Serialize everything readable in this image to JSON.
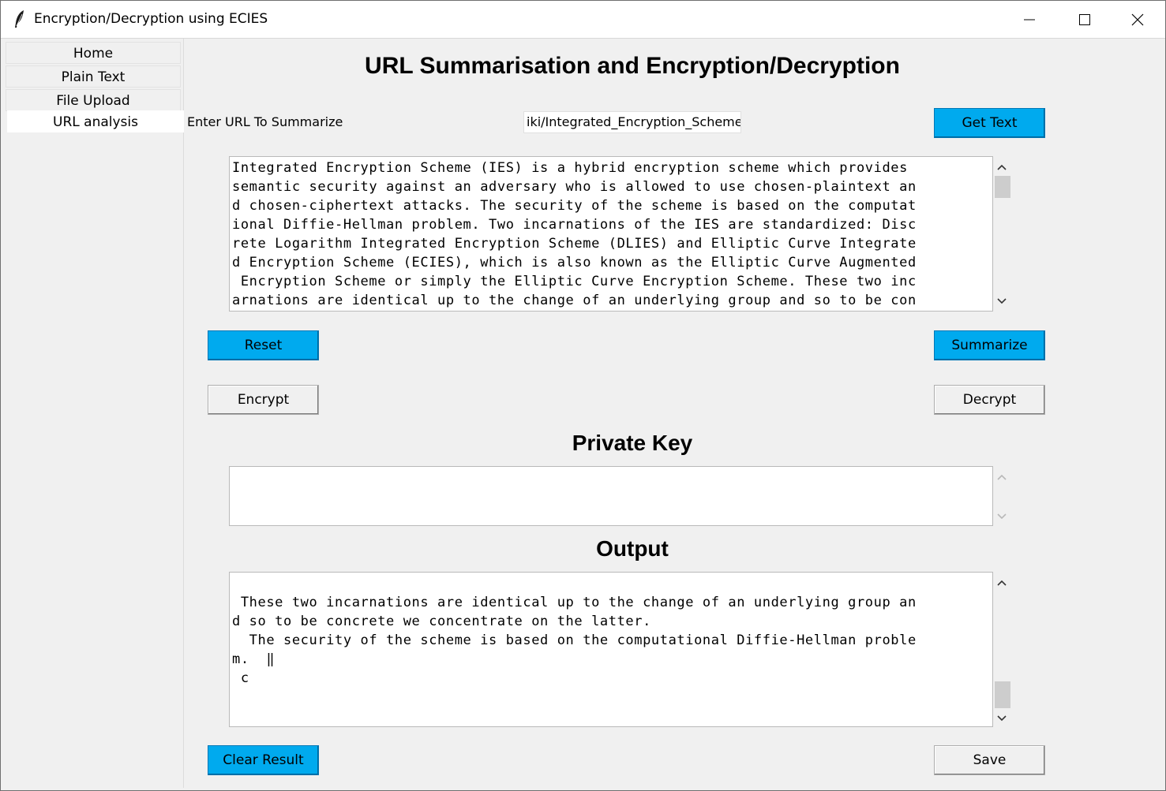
{
  "window": {
    "title": "Encryption/Decryption using ECIES"
  },
  "sidebar": {
    "items": [
      {
        "label": "Home"
      },
      {
        "label": "Plain Text"
      },
      {
        "label": "File Upload"
      },
      {
        "label": "URL analysis"
      }
    ],
    "active_index": 3
  },
  "main": {
    "page_title": "URL Summarisation and Encryption/Decryption",
    "url_label": "Enter URL To Summarize",
    "url_value": "iki/Integrated_Encryption_Scheme",
    "get_text_label": "Get Text",
    "input_text_lines": [
      "Integrated Encryption Scheme (IES) is a hybrid encryption scheme which provides",
      "semantic security against an adversary who is allowed to use chosen-plaintext an",
      "d chosen-ciphertext attacks. The security of the scheme is based on the computat",
      "ional Diffie-Hellman problem. Two incarnations of the IES are standardized: Disc",
      "rete Logarithm Integrated Encryption Scheme (DLIES) and Elliptic Curve Integrate",
      "d Encryption Scheme (ECIES), which is also known as the Elliptic Curve Augmented",
      " Encryption Scheme or simply the Elliptic Curve Encryption Scheme. These two inc",
      "arnations are identical up to the change of an underlying group and so to be con"
    ],
    "reset_label": "Reset",
    "summarize_label": "Summarize",
    "encrypt_label": "Encrypt",
    "decrypt_label": "Decrypt",
    "private_key_heading": "Private Key",
    "private_key_value": "",
    "output_heading": "Output",
    "output_text_lines": [
      "",
      " These two incarnations are identical up to the change of an underlying group an",
      "d so to be concrete we concentrate on the latter.",
      "  The security of the scheme is based on the computational Diffie-Hellman proble",
      "m.  ‖",
      " c"
    ],
    "clear_result_label": "Clear Result",
    "save_label": "Save"
  },
  "colors": {
    "accent_button": "#00aaee",
    "window_bg": "#f0f0f0"
  }
}
